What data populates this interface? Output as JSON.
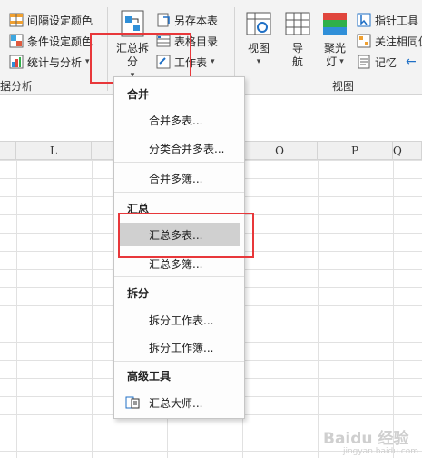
{
  "ribbon": {
    "left_items": [
      {
        "label": "间隔设定颜色",
        "icon": "grid-color-icon"
      },
      {
        "label": "条件设定颜色",
        "icon": "condition-color-icon"
      },
      {
        "label": "统计与分析",
        "icon": "statistics-icon"
      }
    ],
    "left_group_label": "据分析",
    "summary_split": {
      "line1": "汇总拆",
      "line2": "分"
    },
    "middle_items": [
      {
        "label": "另存本表",
        "icon": "save-sheet-icon"
      },
      {
        "label": "表格目录",
        "icon": "table-index-icon"
      },
      {
        "label": "工作表",
        "icon": "worksheet-icon"
      }
    ],
    "view_buttons": [
      {
        "line1": "视图",
        "line2": "",
        "icon": "view-icon"
      },
      {
        "line1": "导",
        "line2": "航",
        "icon": "navigation-icon"
      },
      {
        "line1": "聚光",
        "line2": "灯",
        "icon": "spotlight-icon"
      }
    ],
    "right_items": [
      {
        "label": "指针工具",
        "icon": "pointer-tool-icon"
      },
      {
        "label": "关注相同值",
        "icon": "same-value-icon"
      },
      {
        "label": "记忆",
        "icon": "memory-icon"
      }
    ],
    "view_group_label": "视图"
  },
  "columns": [
    "L",
    "M",
    "N",
    "O",
    "P",
    "Q"
  ],
  "menu": {
    "sections": [
      {
        "header": "合并",
        "items": [
          "合并多表...",
          "分类合并多表...",
          "合并多簿..."
        ]
      },
      {
        "header": "汇总",
        "items": [
          "汇总多表...",
          "汇总多簿..."
        ]
      },
      {
        "header": "拆分",
        "items": [
          "拆分工作表...",
          "拆分工作簿..."
        ]
      },
      {
        "header": "高级工具",
        "items": [
          "汇总大师..."
        ]
      }
    ],
    "highlighted_item": "汇总多表..."
  },
  "watermark": {
    "text": "Baidu 经验",
    "subtext": "jingyan.baidu.com"
  },
  "colors": {
    "highlight": "#e8373a",
    "ribbon_bg": "#f3f3f3",
    "hover": "#d0d0d0",
    "accent_blue": "#1f6fc5"
  }
}
